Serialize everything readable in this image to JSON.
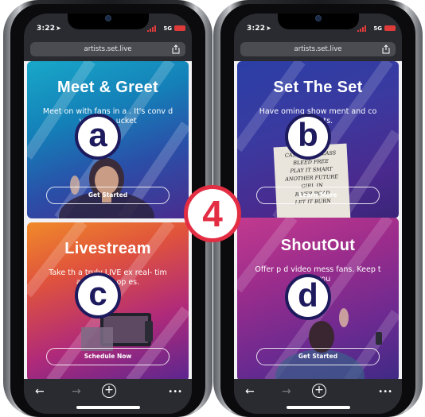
{
  "step_number": "4",
  "badges": [
    "a",
    "b",
    "c",
    "d"
  ],
  "colors": {
    "step_badge": "#e32d43",
    "letter_badge": "#1e1a5e",
    "status_signal": "#e03b3b"
  },
  "phones": [
    {
      "status": {
        "time": "3:22",
        "network": "5G"
      },
      "url": "artists.set.live",
      "cards": [
        {
          "title": "Meet & Greet",
          "description": "Meet on with fans in a . It's conv d you keep ucket",
          "button": "Get Started"
        },
        {
          "title": "Livestream",
          "description": "Take th a truly LIVE ex real- tim and ga ue op es.",
          "button": "Schedule Now"
        }
      ]
    },
    {
      "status": {
        "time": "3:22",
        "network": "5G"
      },
      "url": "artists.set.live",
      "cards": [
        {
          "title": "Set The Set",
          "description": "Have oming show ment and co nsights.",
          "button": "Learn More",
          "setlist": [
            "CASTLE OF GLASS",
            "BLEED FREE",
            "PLAY IT SMART",
            "ANOTHER FUTURE",
            "GIRL IN",
            "RIVER ROAD",
            "LET IT BURN"
          ]
        },
        {
          "title": "ShoutOut",
          "description": "Offer p d video mess fans. Keep t ce you",
          "button": "Get Started"
        }
      ]
    }
  ],
  "toolbar": {
    "back": "←",
    "forward": "→",
    "new_tab": "+",
    "more": "•••"
  }
}
